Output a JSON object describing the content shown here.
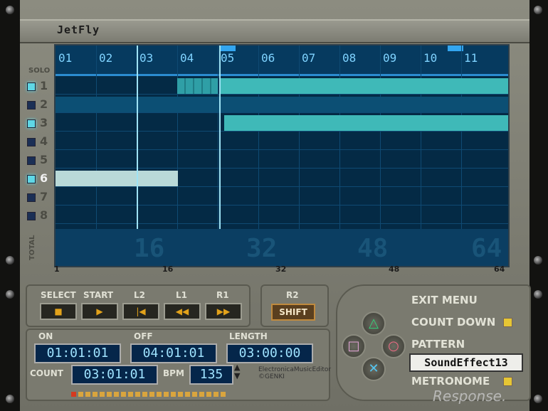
{
  "app": {
    "title": "JetFly"
  },
  "tracks": {
    "header": "SOLO",
    "items": [
      {
        "label": "1",
        "solo": true
      },
      {
        "label": "2",
        "solo": false
      },
      {
        "label": "3",
        "solo": true
      },
      {
        "label": "4",
        "solo": false
      },
      {
        "label": "5",
        "solo": false
      },
      {
        "label": "6",
        "solo": true,
        "selected": true
      },
      {
        "label": "7",
        "solo": false
      },
      {
        "label": "8",
        "solo": false
      }
    ],
    "total_label": "TOTAL"
  },
  "timeline": {
    "bars": [
      "01",
      "02",
      "03",
      "04",
      "05",
      "06",
      "07",
      "08",
      "09",
      "10",
      "11"
    ],
    "total_numbers": [
      "16",
      "32",
      "48",
      "64"
    ],
    "axis_ticks": [
      "1",
      "16",
      "32",
      "48",
      "64"
    ]
  },
  "transport": {
    "buttons": [
      {
        "label": "SELECT",
        "icon": "stop-icon",
        "glyph": "■"
      },
      {
        "label": "START",
        "icon": "play-icon",
        "glyph": "▶"
      },
      {
        "label": "L2",
        "icon": "skip-start-icon",
        "glyph": "|◀"
      },
      {
        "label": "L1",
        "icon": "rewind-icon",
        "glyph": "◀◀"
      },
      {
        "label": "R1",
        "icon": "fast-forward-icon",
        "glyph": "▶▶"
      }
    ],
    "r2_label": "R2",
    "shift_label": "SHIFT"
  },
  "fields": {
    "on_label": "ON",
    "on_value": "01:01:01",
    "off_label": "OFF",
    "off_value": "04:01:01",
    "length_label": "LENGTH",
    "length_value": "03:00:00",
    "count_label": "COUNT",
    "count_value": "03:01:01",
    "bpm_label": "BPM",
    "bpm_value": "135"
  },
  "menu": {
    "exit": "EXIT MENU",
    "count_down": "COUNT DOWN",
    "pattern": "PATTERN",
    "pattern_value": "SoundEffect13",
    "metronome": "METRONOME"
  },
  "pad": {
    "triangle": "△",
    "square": "□",
    "circle": "○",
    "cross": "✕"
  },
  "branding": {
    "line1": "ElectronicaMusicEditor",
    "line2": "©GENKI",
    "watermark": "Response."
  },
  "colors": {
    "note_teal": "#3fb9b8",
    "note_pale": "#b9d9d8",
    "grid_bg": "#042a45"
  }
}
